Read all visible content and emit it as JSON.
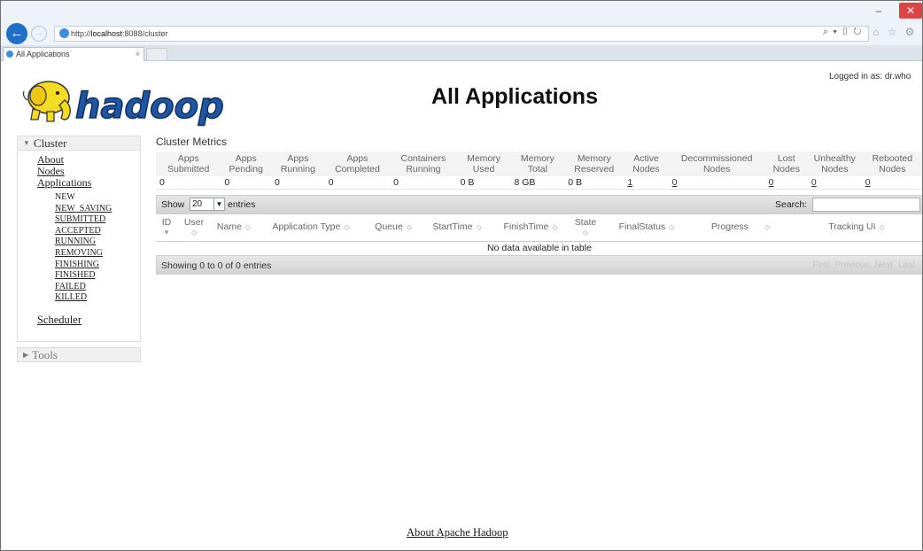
{
  "browser": {
    "url_prefix": "http://",
    "url_host": "localhost",
    "url_rest": ":8088/cluster",
    "tab_title": "All Applications",
    "tab_close": "×",
    "address_tools": "⌕ ▾ ▯ ↻",
    "right_tools": "⌂ ☆ ⚙",
    "back_symbol": "←",
    "forward_symbol": "→",
    "min_symbol": "–",
    "max_symbol": "▫",
    "close_symbol": "✕"
  },
  "header": {
    "title": "All Applications",
    "login": "Logged in as: dr.who",
    "logo_text": "hadoop",
    "logo_color": "#f2d51c"
  },
  "sidebar": {
    "cluster_label": "Cluster",
    "cluster_links": [
      "About",
      "Nodes",
      "Applications"
    ],
    "app_states": [
      "NEW",
      "NEW_SAVING",
      "SUBMITTED",
      "ACCEPTED",
      "RUNNING",
      "REMOVING",
      "FINISHING",
      "FINISHED",
      "FAILED",
      "KILLED"
    ],
    "scheduler_label": "Scheduler",
    "tools_label": "Tools"
  },
  "metrics": {
    "caption": "Cluster Metrics",
    "headers": [
      [
        "Apps",
        "Submitted"
      ],
      [
        "Apps",
        "Pending"
      ],
      [
        "Apps",
        "Running"
      ],
      [
        "Apps",
        "Completed"
      ],
      [
        "Containers",
        "Running"
      ],
      [
        "Memory",
        "Used"
      ],
      [
        "Memory",
        "Total"
      ],
      [
        "Memory",
        "Reserved"
      ],
      [
        "Active",
        "Nodes"
      ],
      [
        "Decommissioned",
        "Nodes"
      ],
      [
        "Lost",
        "Nodes"
      ],
      [
        "Unhealthy",
        "Nodes"
      ],
      [
        "Rebooted",
        "Nodes"
      ]
    ],
    "values": [
      "0",
      "0",
      "0",
      "0",
      "0",
      "0 B",
      "8 GB",
      "0 B",
      "1",
      "0",
      "0",
      "0",
      "0"
    ]
  },
  "list": {
    "show_label": "Show",
    "page_size": "20",
    "entries_label": "entries",
    "search_label": "Search:",
    "columns": [
      "ID",
      "User",
      "Name",
      "Application Type",
      "Queue",
      "StartTime",
      "FinishTime",
      "State",
      "FinalStatus",
      "Progress",
      "Tracking UI"
    ],
    "empty_message": "No data available in table",
    "showing": "Showing 0 to 0 of 0 entries",
    "pager": [
      "First",
      "Previous",
      "Next",
      "Last"
    ]
  },
  "footer": {
    "link": "About Apache Hadoop"
  }
}
